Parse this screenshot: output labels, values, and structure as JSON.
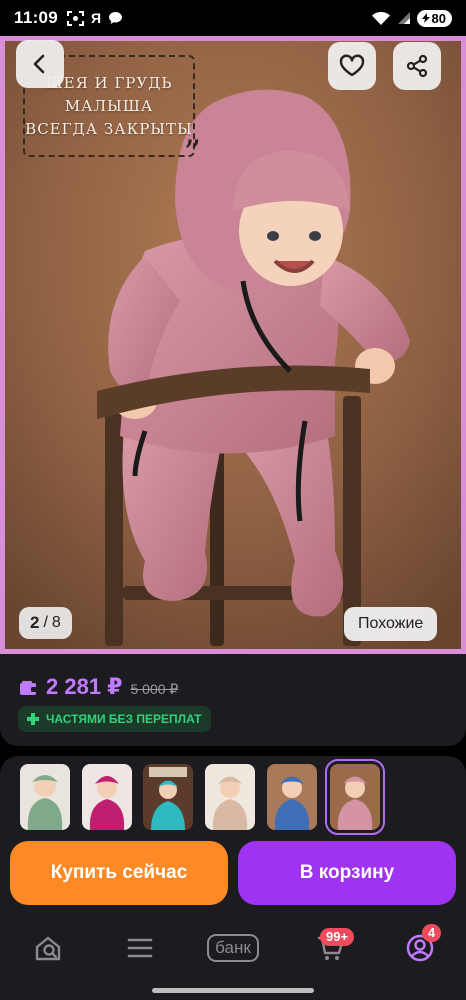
{
  "status_bar": {
    "time": "11:09",
    "yandex_letter": "Я",
    "battery": "80",
    "icons": [
      "screenshot-icon",
      "yandex-icon",
      "chat-bubble-icon",
      "wifi-icon",
      "signal-icon",
      "battery-icon"
    ]
  },
  "gallery": {
    "caption_lines": [
      "ШЕЯ И ГРУДЬ",
      "МАЛЫША",
      "ВСЕГДА ЗАКРЫТЫ"
    ],
    "current": "2",
    "separator": "/",
    "total": "8",
    "similar_label": "Похожие",
    "frame_color": "#d98fd8"
  },
  "price": {
    "current": "2 281 ₽",
    "old": "5 000 ₽",
    "installment_label": "ЧАСТЯМИ БЕЗ ПЕРЕПЛАТ",
    "accent": "#c07bff"
  },
  "thumbnails": [
    {
      "color": "sage-green",
      "selected": false
    },
    {
      "color": "magenta",
      "selected": false
    },
    {
      "color": "turquoise",
      "selected": false
    },
    {
      "color": "beige",
      "selected": false
    },
    {
      "color": "blue",
      "selected": false
    },
    {
      "color": "pink",
      "selected": true
    }
  ],
  "actions": {
    "buy_now": "Купить сейчас",
    "add_to_cart": "В корзину",
    "buy_color": "#ff8a25",
    "cart_color": "#a032f2"
  },
  "bottom_nav": {
    "bank_label": "банк",
    "cart_badge": "99+",
    "profile_badge": "4",
    "items": [
      "search-home-icon",
      "catalog-menu-icon",
      "bank-icon",
      "cart-icon",
      "profile-icon"
    ]
  }
}
